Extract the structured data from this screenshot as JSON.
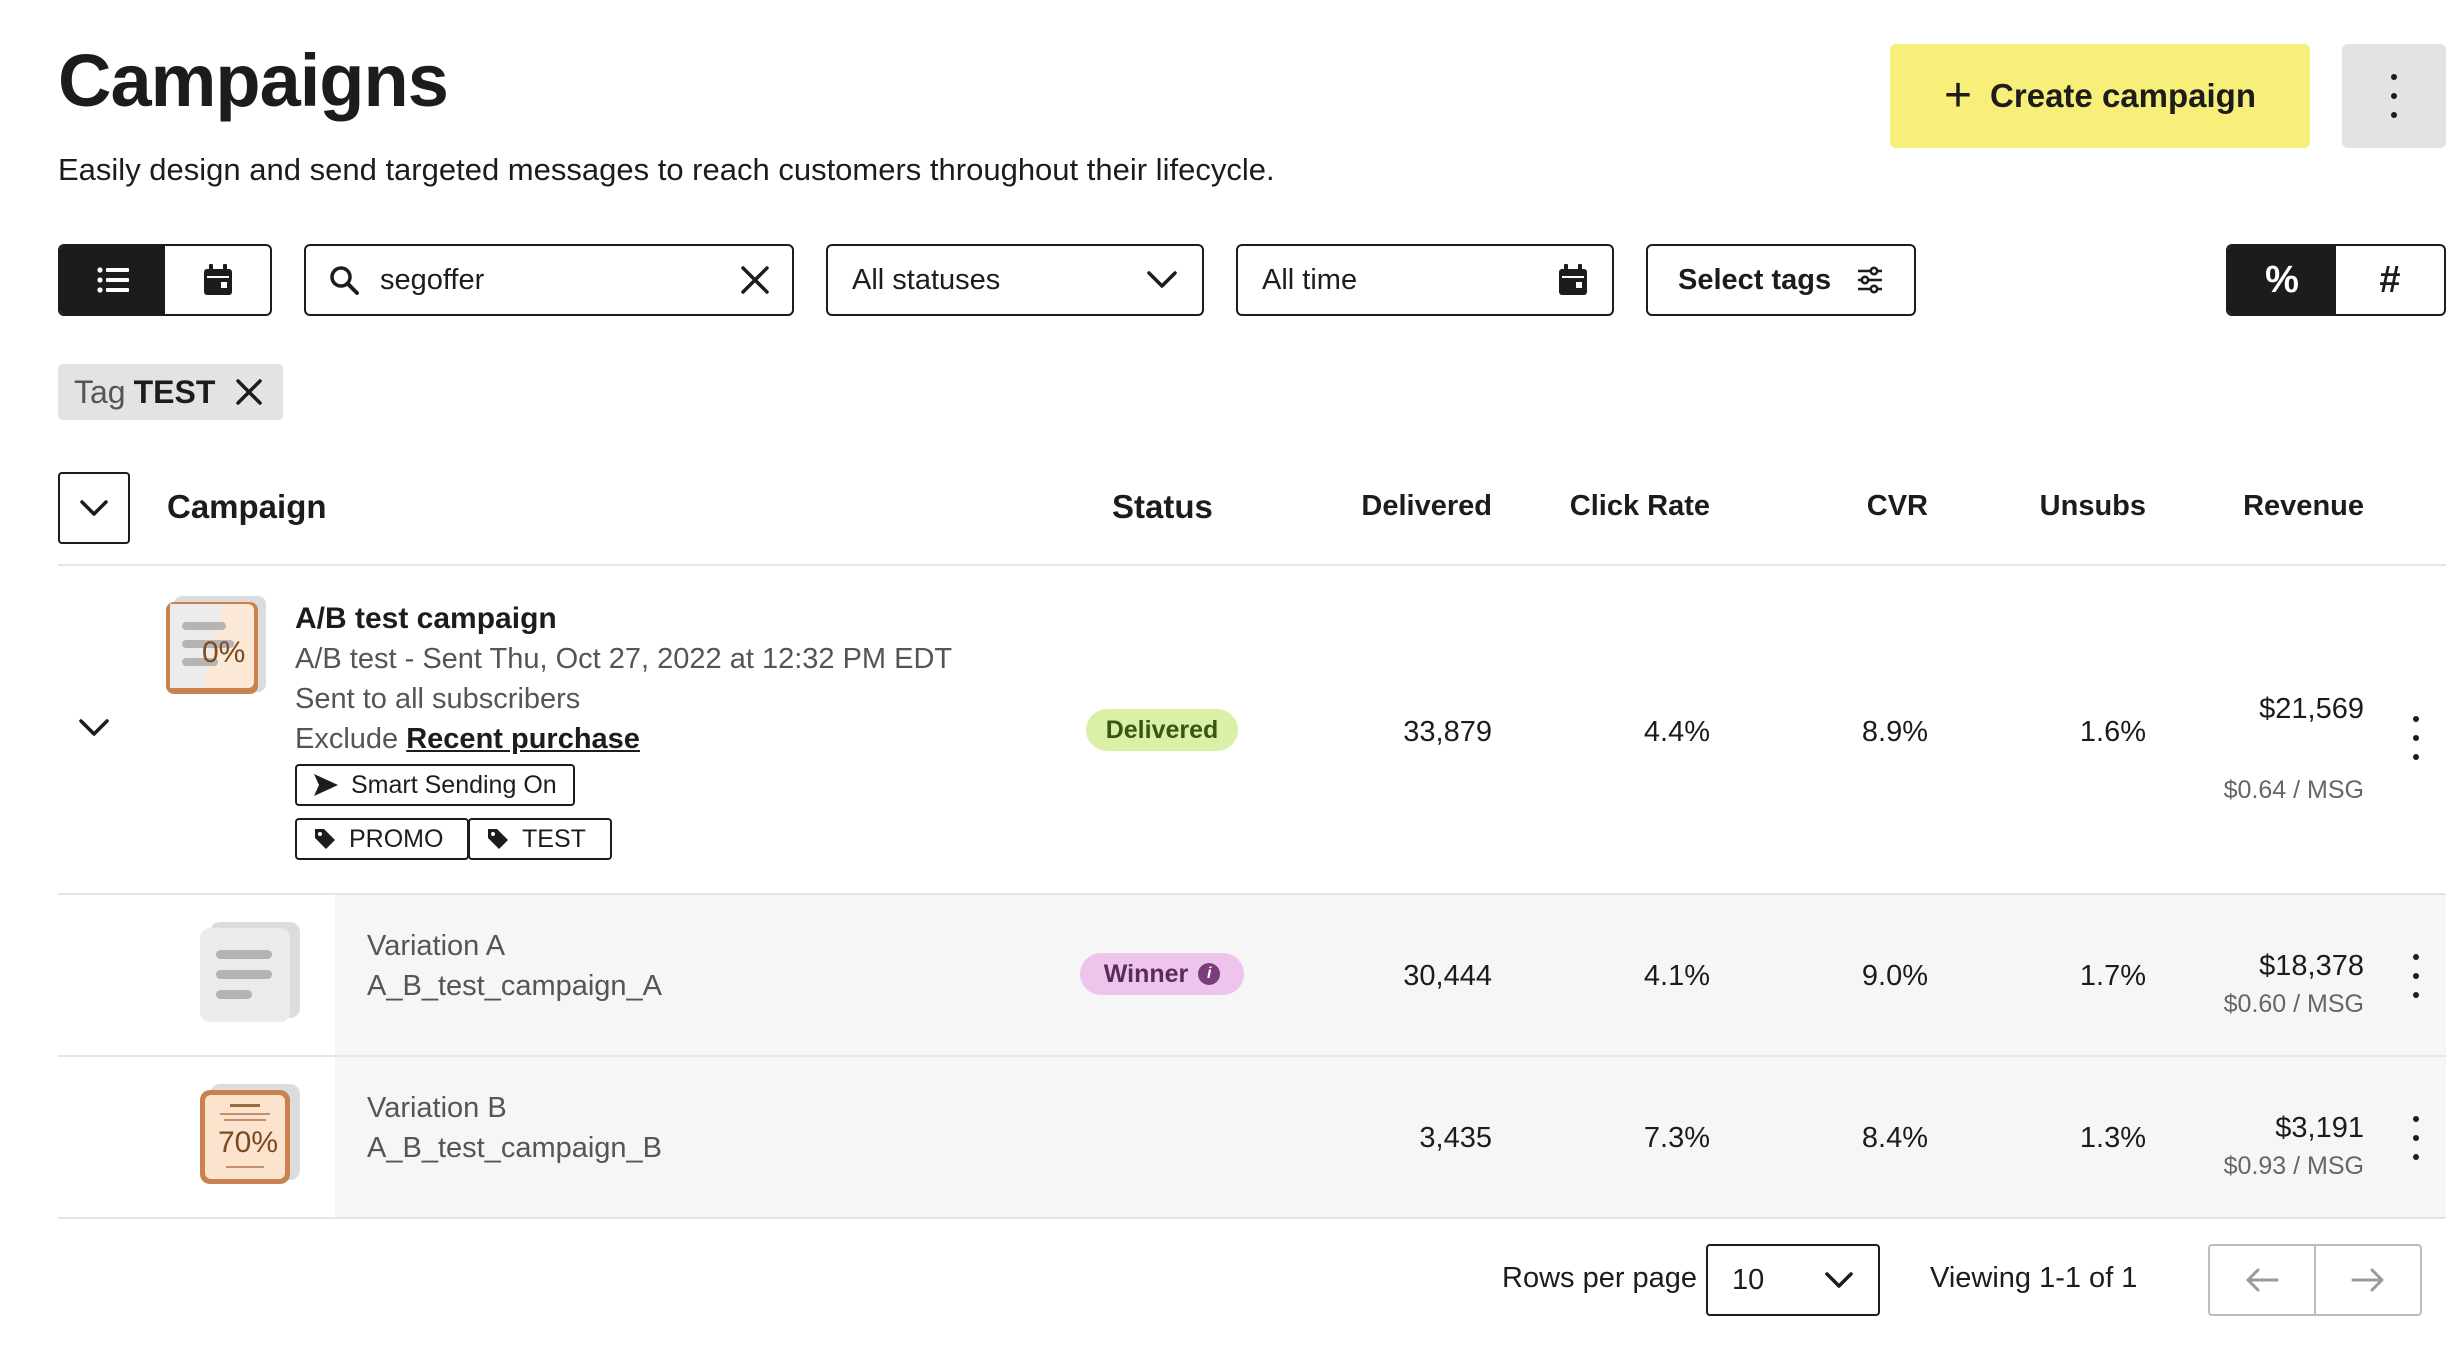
{
  "header": {
    "title": "Campaigns",
    "subtitle": "Easily design and send targeted messages to reach customers throughout their lifecycle.",
    "create_label": "Create campaign"
  },
  "filters": {
    "search_value": "segoffer",
    "status": "All statuses",
    "time": "All time",
    "tags": "Select tags",
    "metric_percent": "%",
    "metric_count": "#"
  },
  "active_tag": {
    "key": "Tag",
    "value": "TEST"
  },
  "columns": {
    "campaign": "Campaign",
    "status": "Status",
    "delivered": "Delivered",
    "click_rate": "Click Rate",
    "cvr": "CVR",
    "unsubs": "Unsubs",
    "revenue": "Revenue"
  },
  "campaign": {
    "name": "A/B test campaign",
    "sent": "A/B test - Sent Thu, Oct 27, 2022 at 12:32 PM EDT",
    "audience": "Sent to all subscribers",
    "exclude_prefix": "Exclude",
    "exclude_link": "Recent purchase",
    "smart_sending": "Smart Sending On",
    "tags": [
      "PROMO",
      "TEST"
    ],
    "status": "Delivered",
    "delivered": "33,879",
    "click_rate": "4.4%",
    "cvr": "8.9%",
    "unsubs": "1.6%",
    "revenue": "$21,569",
    "per_msg": "$0.64 / MSG",
    "thumb_text": "0%"
  },
  "variations": [
    {
      "name": "Variation A",
      "subject": "A_B_test_campaign_A",
      "status": "Winner",
      "delivered": "30,444",
      "click_rate": "4.1%",
      "cvr": "9.0%",
      "unsubs": "1.7%",
      "revenue": "$18,378",
      "per_msg": "$0.60 / MSG"
    },
    {
      "name": "Variation B",
      "subject": "A_B_test_campaign_B",
      "status": "",
      "delivered": "3,435",
      "click_rate": "7.3%",
      "cvr": "8.4%",
      "unsubs": "1.3%",
      "revenue": "$3,191",
      "per_msg": "$0.93 / MSG",
      "thumb_text": "70%"
    }
  ],
  "pagination": {
    "rows_label": "Rows per page",
    "rows_value": "10",
    "viewing": "Viewing 1-1 of 1"
  },
  "colors": {
    "accent_yellow": "#f8ee7a",
    "delivered_badge": "#d9f0a6",
    "winner_badge": "#ecc4ec",
    "thumbnail_orange": "#c9824e"
  }
}
